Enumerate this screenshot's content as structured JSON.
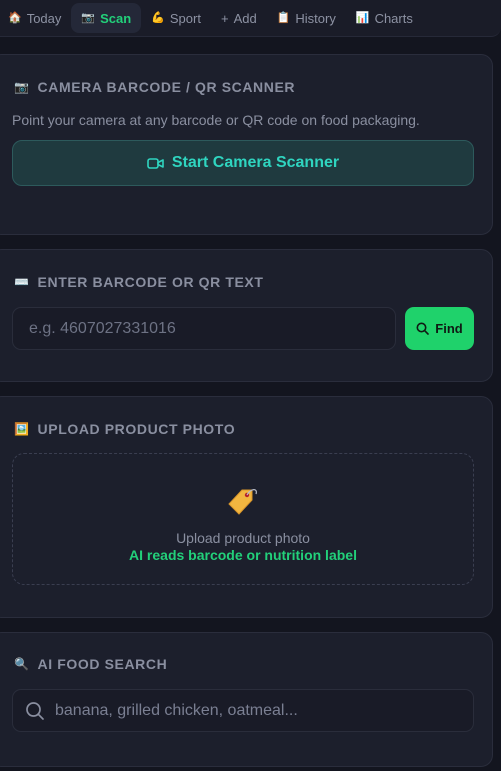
{
  "nav": {
    "tabs": [
      {
        "icon": "🏠",
        "label": "Today"
      },
      {
        "icon": "📷",
        "label": "Scan"
      },
      {
        "icon": "💪",
        "label": "Sport"
      },
      {
        "icon": "+",
        "label": "Add"
      },
      {
        "icon": "📋",
        "label": "History"
      },
      {
        "icon": "📊",
        "label": "Charts"
      }
    ],
    "active_index": 1
  },
  "camera": {
    "icon": "📷",
    "title": "CAMERA BARCODE / QR SCANNER",
    "hint": "Point your camera at any barcode or QR code on food packaging.",
    "button_label": "Start Camera Scanner",
    "button_icon": "video-camera-icon"
  },
  "barcode": {
    "icon": "⌨️",
    "title": "ENTER BARCODE OR QR TEXT",
    "placeholder": "e.g. 4607027331016",
    "find_label": "Find"
  },
  "upload": {
    "icon": "🖼️",
    "title": "UPLOAD PRODUCT PHOTO",
    "line1": "Upload product photo",
    "line2": "AI reads barcode or nutrition label"
  },
  "ai_search": {
    "icon": "🔍",
    "title": "AI FOOD SEARCH",
    "placeholder": "banana, grilled chicken, oatmeal..."
  },
  "colors": {
    "accent_green": "#22d07a",
    "accent_teal": "#2fd5c0",
    "background": "#13151f",
    "card": "#1c1f2c"
  }
}
